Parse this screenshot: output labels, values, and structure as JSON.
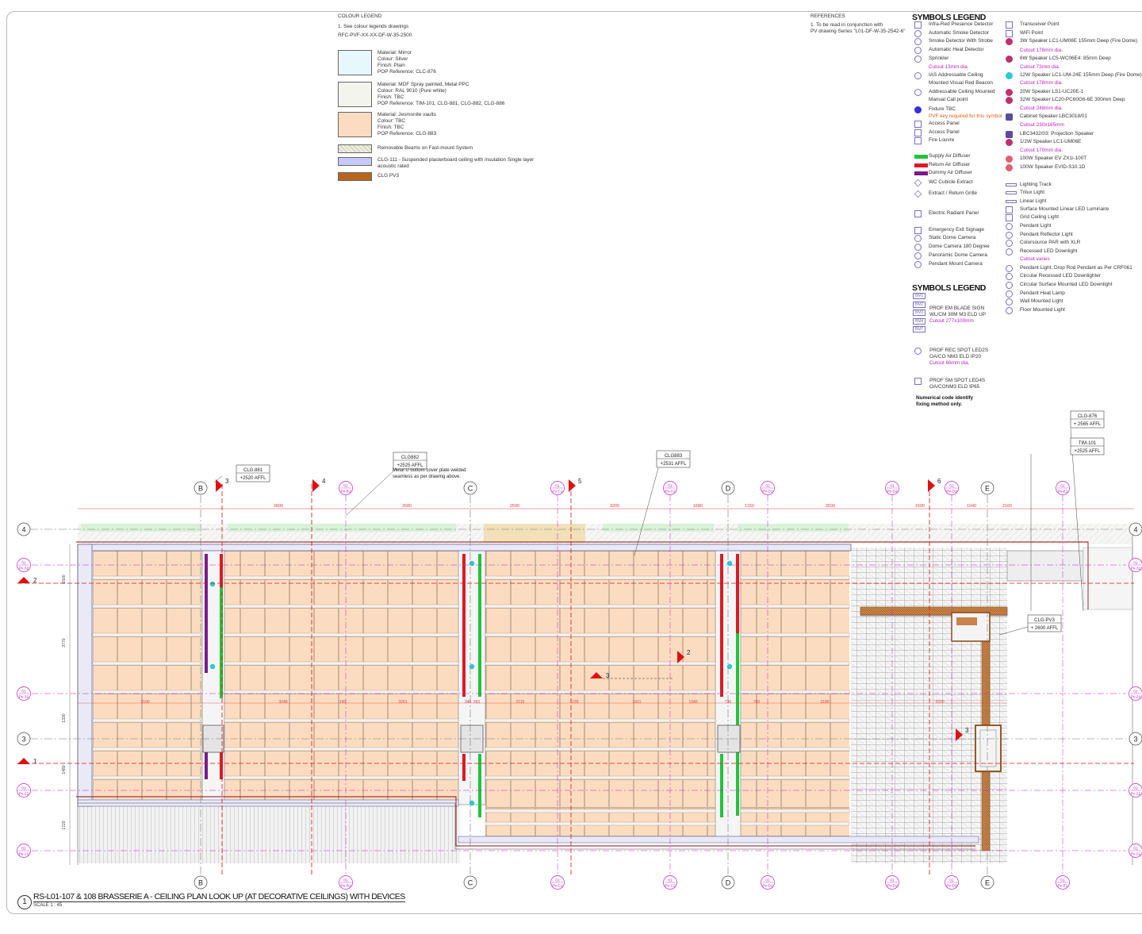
{
  "colour_legend": {
    "title": "COLOUR LEGEND",
    "note": "1. See colour legends drawings",
    "ref": "RFC-PVF-XX-XX-DF-W-35-2500",
    "items": [
      {
        "lines": [
          "Material: Mirror",
          "Colour: Silver",
          "Finish: Plain",
          "POP Reference: CLC-876"
        ],
        "color": "#e6f8fc"
      },
      {
        "lines": [
          "Material: MDF Spray painted, Metal PPC",
          "Colour: RAL 9010 (Pure white)",
          "Finish: TBC",
          "POP Reference: TIM-101, CLG-881, CLG-882, CLG-886"
        ],
        "color": "#f4f4ee"
      },
      {
        "lines": [
          "Material: Jesmonite vaults",
          "Colour: TBC",
          "Finish: TBC",
          "POP Reference: CLG-883"
        ],
        "color": "#fcdcc0"
      },
      {
        "lines": [
          "Removable Beams on Fast-mount System"
        ],
        "color": "#eeeede"
      },
      {
        "lines": [
          "CLG-111 - Suspended plasterboard ceiling with insulation Single layer",
          "acoustic rated"
        ],
        "color": "#c8c8f8"
      },
      {
        "lines": [
          "CLG PV3"
        ],
        "color": "#b8661e"
      }
    ]
  },
  "references": {
    "title": "REFERENCES",
    "lines": [
      "1. To be read in conjunction with",
      "PV drawing Series \"L01-DF-W-35-2542-6\""
    ]
  },
  "symbols_legend": {
    "title": "SYMBOLS LEGEND",
    "col1": [
      {
        "text": "Infra-Red Presence Detector"
      },
      {
        "text": "Automatic Smoke Detector"
      },
      {
        "text": "Smoke Detector With Strobe"
      },
      {
        "text": "Automatic Heat Detector"
      },
      {
        "text": "Sprinkler"
      },
      {
        "text": "Cutout 13mm dia.",
        "tone": "mag"
      },
      {
        "text": "IAS Addressable Ceiling"
      },
      {
        "text": "Mounted Visual Red Beacon"
      },
      {
        "text": "Addressable Ceiling Mounted"
      },
      {
        "text": "Manual Call point"
      },
      {
        "text": "Fixture TBC"
      },
      {
        "text": "PVF key required for this symbol",
        "tone": "org"
      },
      {
        "text": "Access Panel"
      },
      {
        "text": "Access Panel"
      },
      {
        "text": "Fire Louvre"
      },
      {
        "text": "Supply Air Diffuser"
      },
      {
        "text": "Return Air Diffuser"
      },
      {
        "text": "Dummy Air Diffuser"
      },
      {
        "text": "WC Cubicle Extract"
      },
      {
        "text": "Extract / Return Grille"
      },
      {
        "text": "Electric Radiant Panel"
      },
      {
        "text": "Emergency Exit Signage"
      },
      {
        "text": "Static Dome Camera"
      },
      {
        "text": "Dome Camera 180 Degree"
      },
      {
        "text": "Panoramic Dome Camera"
      },
      {
        "text": "Pendant Mount Camera"
      }
    ],
    "col2": [
      {
        "text": "Transceiver Point"
      },
      {
        "text": "WiFi Point"
      },
      {
        "text": "3W Speaker LC1-UM06E 155mm Deep (Fire Dome)"
      },
      {
        "text": "Cutout 178mm dia.",
        "tone": "mag"
      },
      {
        "text": "6W Speaker LC5-WC06E4: 85mm Deep"
      },
      {
        "text": "Cutout 73mm dia.",
        "tone": "mag"
      },
      {
        "text": "12W Speaker LC1-UM-24E 155mm Deep (Fire Dome)"
      },
      {
        "text": "Cutout 178mm dia.",
        "tone": "mag"
      },
      {
        "text": "20W Speaker LS1-UC20E-1"
      },
      {
        "text": "32W Speaker LC20-PC60G6-6E 300mm Deep"
      },
      {
        "text": "Cutout 248mm dia.",
        "tone": "mag"
      },
      {
        "text": "Cabinet Speaker LBC3018/01"
      },
      {
        "text": "Cutout 230x165mm",
        "tone": "mag"
      },
      {
        "text": "LBC3432/03: Projection Speaker"
      },
      {
        "text": "1/2W Speaker LC1-UM06E"
      },
      {
        "text": "Cutout 170mm dia.",
        "tone": "mag"
      },
      {
        "text": "100W Speaker EV ZX1i-100T"
      },
      {
        "text": "100W Speaker EVID-S10.1D"
      },
      {
        "text": "Lighting Track"
      },
      {
        "text": "Trilux Light"
      },
      {
        "text": "Linear Light"
      },
      {
        "text": "Surface Mounted Linear LED Luminaire"
      },
      {
        "text": "Grid Ceiling Light"
      },
      {
        "text": "Pendant Light"
      },
      {
        "text": "Pendant Reflector Light"
      },
      {
        "text": "Colorsource PAR with XLR"
      },
      {
        "text": "Recessed LED Downlight"
      },
      {
        "text": "Cutout varies",
        "tone": "mag"
      },
      {
        "text": "Pendant Light, Drop Rod Pendant as Per CRF061"
      },
      {
        "text": "Circular Recessed LED Downlighter"
      },
      {
        "text": "Circular Surface Mounted LED Downlight"
      },
      {
        "text": "Pendant Heat Lamp"
      },
      {
        "text": "Wall Mounted Light"
      },
      {
        "text": "Floor Mounted Light"
      }
    ]
  },
  "symbols_legend_2": {
    "title": "SYMBOLS LEGEND",
    "codes": [
      "BM1",
      "BM2",
      "BM3",
      "BM4",
      "BM7"
    ],
    "blade": [
      "PROF EM BLADE SIGN",
      "WL/CM 30M M3 ELD UP"
    ],
    "blade_cutout": "Cutout 277x100mm",
    "spot_rec": [
      "PROF REC SPOT LED2S",
      "OA/CO NM3 ELD IP20"
    ],
    "spot_rec_cutout": "Cutout 68mm dia.",
    "spot_sm": [
      "PROF SM SPOT LED4S",
      "OA/CONM3 ELD IP65"
    ],
    "note": [
      "Numerical code identify",
      "fixing method only."
    ]
  },
  "callouts": [
    {
      "l1": "CLG.881",
      "l2": "+2520 AFFL"
    },
    {
      "l1": "CLG882",
      "l2": "+2525 AFFL"
    },
    {
      "l1": "CLG883",
      "l2": "+2531 AFFL"
    },
    {
      "l1": "CLG-876",
      "l2": "+ 2565 AFFL"
    },
    {
      "l1": "TIM-101",
      "l2": "+2525 AFFL"
    },
    {
      "l1": "CLG-PV3",
      "l2": "+ 2600 AFFL"
    }
  ],
  "beam_note": [
    "Metal U bottom cover plate welded",
    "seamless as per drawing above."
  ],
  "grid": {
    "col_letters": [
      "B",
      "C",
      "D",
      "E"
    ],
    "pv_cols": [
      "Pv-B1",
      "Pv-C1",
      "Pv-C2",
      "Pv-D1",
      "Pv-D2",
      "Pv-D3",
      "Pv-E1"
    ],
    "pv_prefix": "01",
    "rows": [
      "4",
      "3"
    ],
    "pv_rows": [
      "Pv-32",
      "Pv-31",
      "Pv-22",
      "Pv-21"
    ]
  },
  "sections": [
    "1",
    "2",
    "2",
    "3",
    "3",
    "3",
    "4",
    "5",
    "6"
  ],
  "top_dims": [
    "3800",
    "3580",
    "2500",
    "3200",
    "1680",
    "1150",
    "3500",
    "1690",
    "1040",
    "2160"
  ],
  "mid_dims": [
    "3100",
    "3249",
    "150",
    "3251",
    "340",
    "393",
    "2110",
    "1139",
    "1911",
    "1340",
    "730",
    "760",
    "3189",
    "2600"
  ],
  "left_dims": [
    "1500",
    "3770",
    "1330",
    "1480",
    "1720"
  ],
  "title_block": {
    "number": "1",
    "title": "RS-L01-107 & 108 BRASSERIE A  - CEILING PLAN LOOK UP (AT DECORATIVE CEILINGS) WITH DEVICES",
    "scale": "SCALE 1 : 45"
  },
  "colors": {
    "jesmonite": "#fcdcc0",
    "supply": "#22c43a",
    "return": "#dd1a22",
    "dummy": "#7b1a8a",
    "pv": "#c020c0",
    "pv3": "#b8661e",
    "section": "#e01010"
  }
}
